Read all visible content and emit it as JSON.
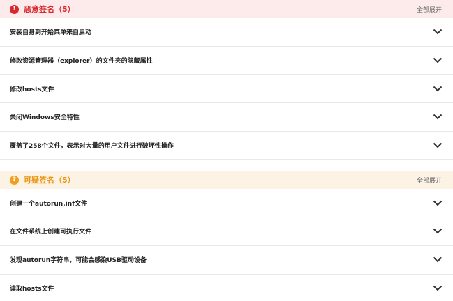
{
  "malicious": {
    "title": "恶意签名（5）",
    "expand_all": "全部展开",
    "items": [
      "安装自身到开始菜单来自启动",
      "修改资源管理器（explorer）的文件夹的隐藏属性",
      "修改hosts文件",
      "关闭Windows安全特性",
      "覆盖了258个文件，表示对大量的用户文件进行破坏性操作"
    ]
  },
  "suspicious": {
    "title": "可疑签名（5）",
    "expand_all": "全部展开",
    "items": [
      "创建一个autorun.inf文件",
      "在文件系统上创建可执行文件",
      "发现autorun字符串，可能会感染USB驱动设备",
      "读取hosts文件"
    ]
  },
  "icons": {
    "malicious": "exclamation-circle-icon",
    "suspicious": "question-circle-icon",
    "row": "chevron-down-icon"
  },
  "colors": {
    "malicious_accent": "#d7282f",
    "malicious_bg": "#fdeaea",
    "suspicious_accent": "#e89514",
    "suspicious_bg": "#fdf3e4"
  }
}
